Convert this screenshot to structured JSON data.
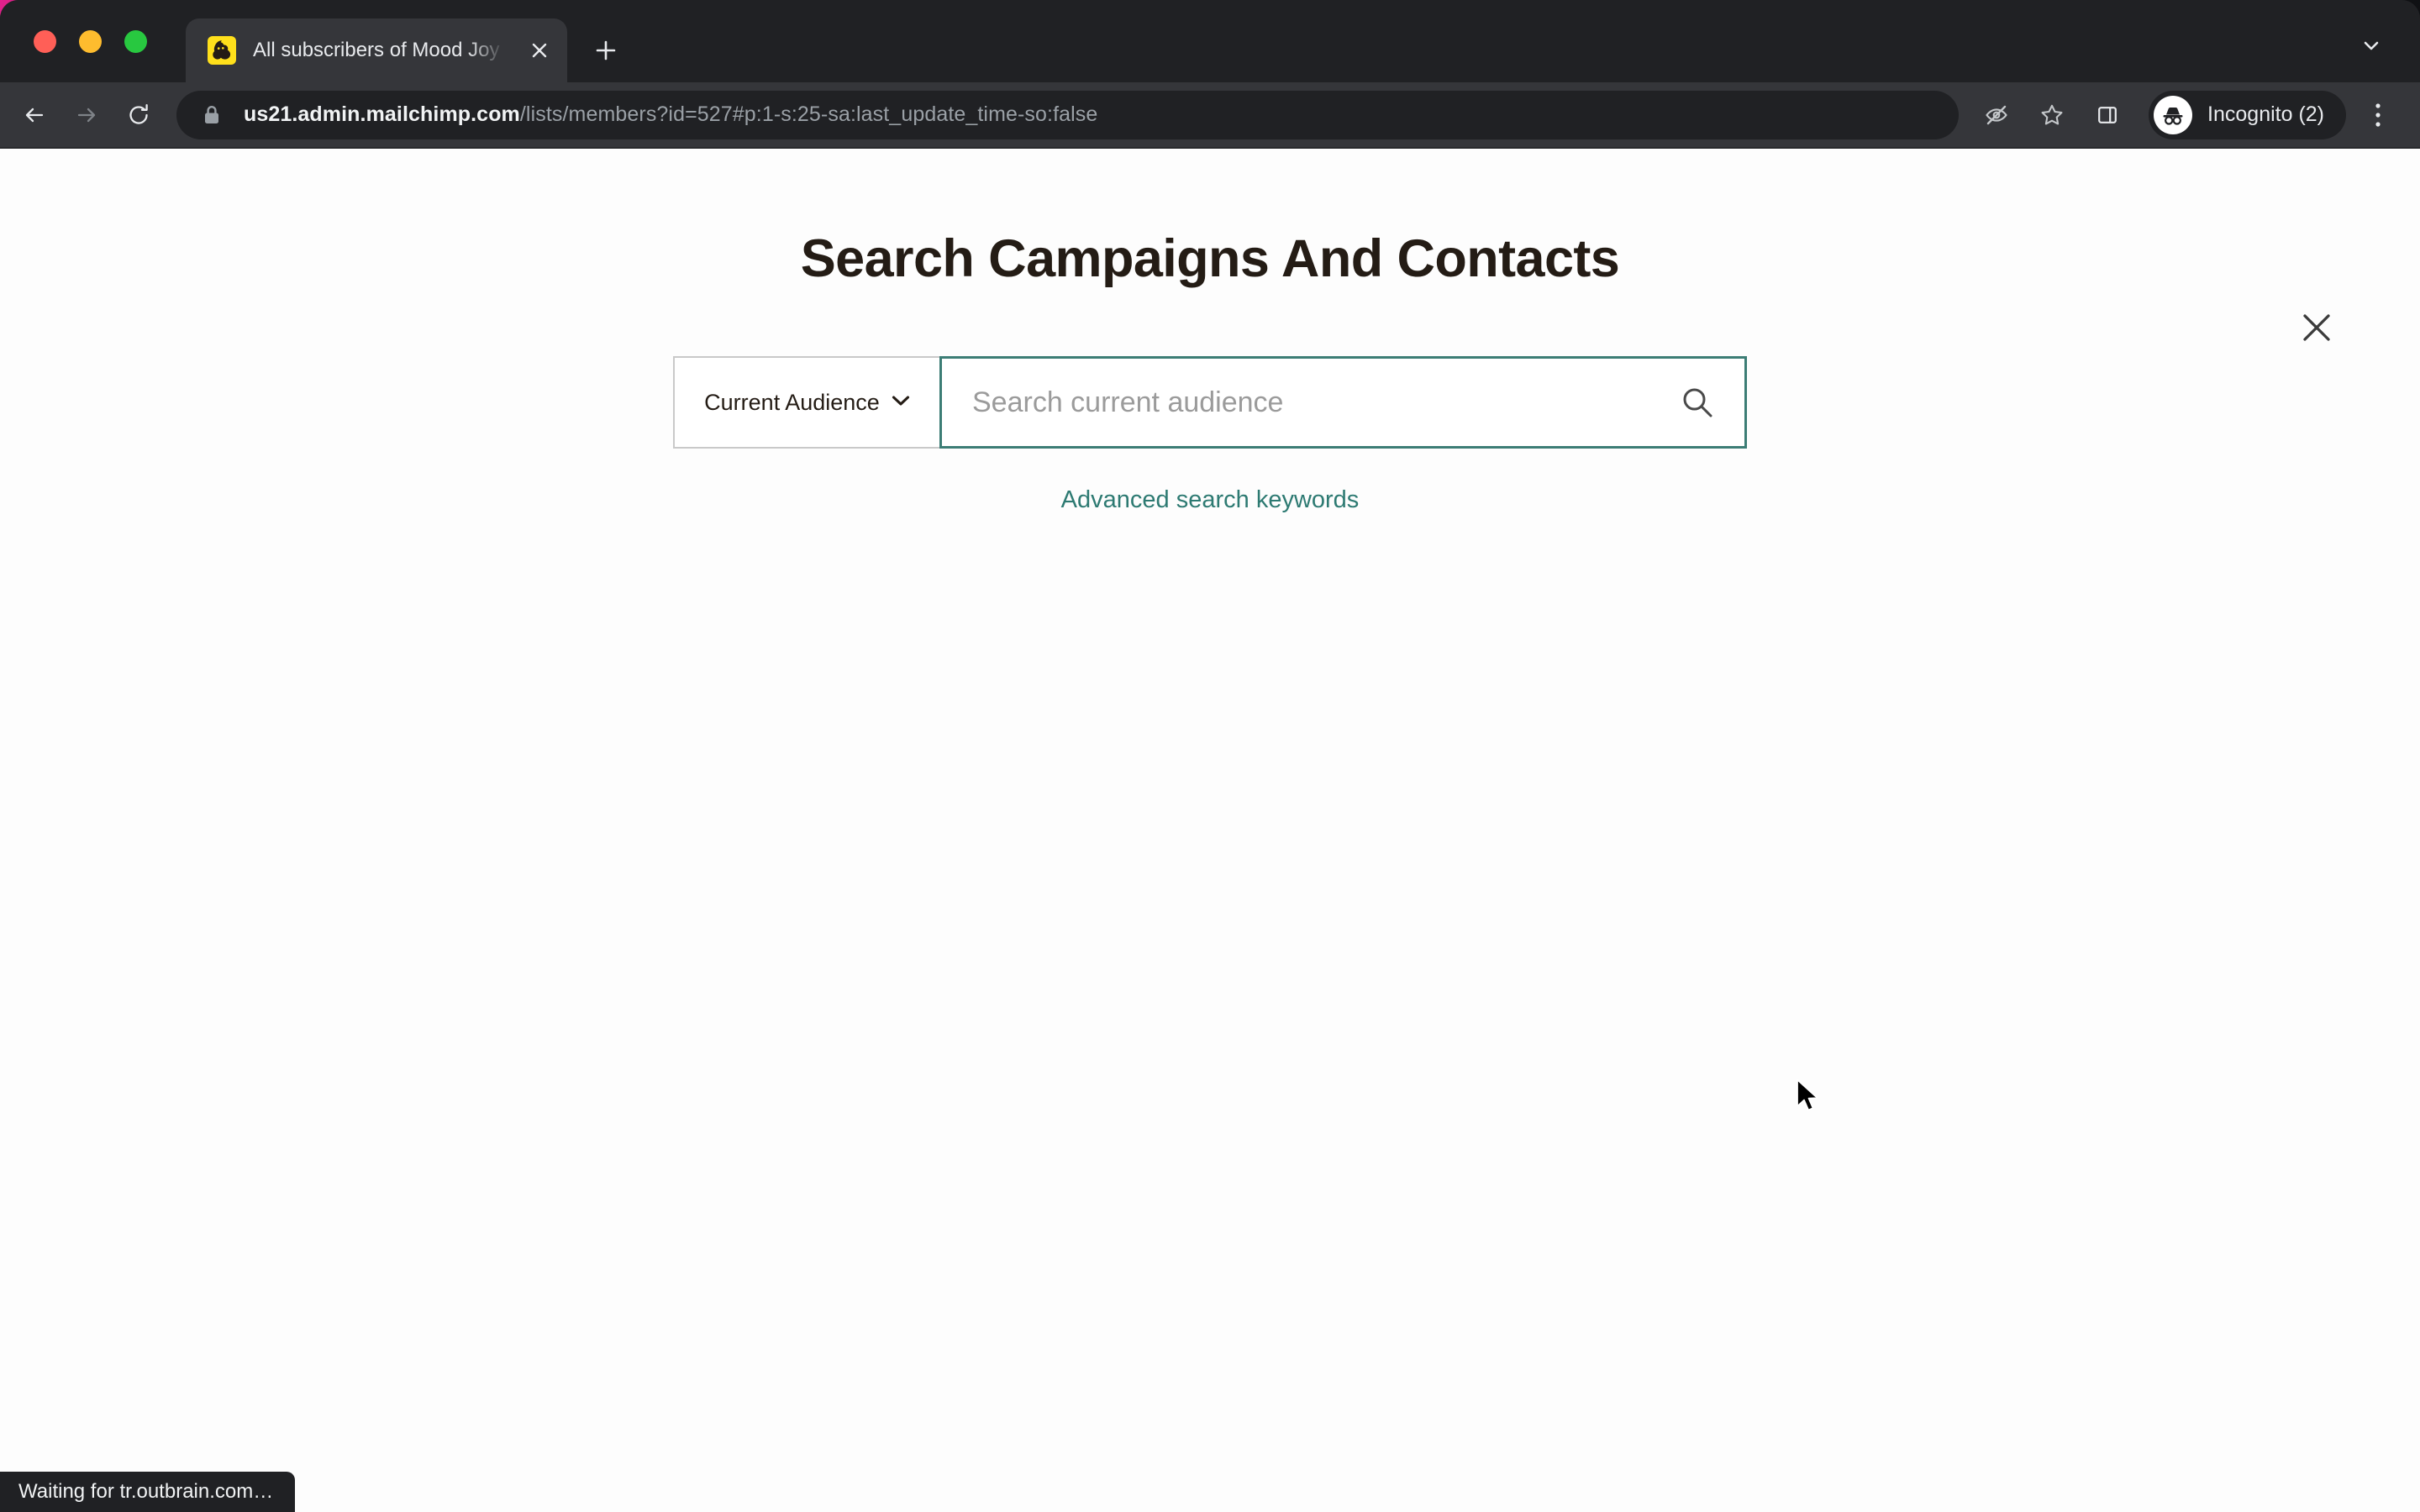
{
  "browser": {
    "traffic_lights": [
      "close",
      "minimize",
      "maximize"
    ],
    "tab": {
      "title": "All subscribers of Mood Joy | M",
      "favicon_name": "mailchimp-favicon",
      "close_label": "×"
    },
    "new_tab_label": "+",
    "tab_search_label": "⌄",
    "nav": {
      "back_label": "←",
      "forward_label": "→",
      "reload_label": "⟳"
    },
    "omnibox": {
      "lock_icon": "lock-icon",
      "host": "us21.admin.mailchimp.com",
      "path": "/lists/members?id=527#p:1-s:25-sa:last_update_time-so:false",
      "full_url": "us21.admin.mailchimp.com/lists/members?id=527#p:1-s:25-sa:last_update_time-so:false"
    },
    "actions": {
      "tracking_protection": "eye-slash-icon",
      "bookmark": "star-icon",
      "side_panel": "side-panel-icon",
      "menu": "three-dot-menu-icon"
    },
    "profile": {
      "label": "Incognito (2)",
      "avatar_icon": "incognito-avatar-icon"
    },
    "status": {
      "text": "Waiting for tr.outbrain.com…"
    }
  },
  "page": {
    "close_label": "×",
    "title": "Search Campaigns And Contacts",
    "search": {
      "scope_label": "Current Audience",
      "scope_chevron": "⌄",
      "input_value": "",
      "placeholder": "Search current audience",
      "submit_icon": "search-icon"
    },
    "advanced_link": "Advanced search keywords"
  },
  "colors": {
    "accent_teal": "#2d7a72",
    "focus_border": "#3c7d75",
    "chrome_dark": "#202124",
    "toolbar_dark": "#35363a",
    "mailchimp_yellow": "#ffe01b"
  }
}
